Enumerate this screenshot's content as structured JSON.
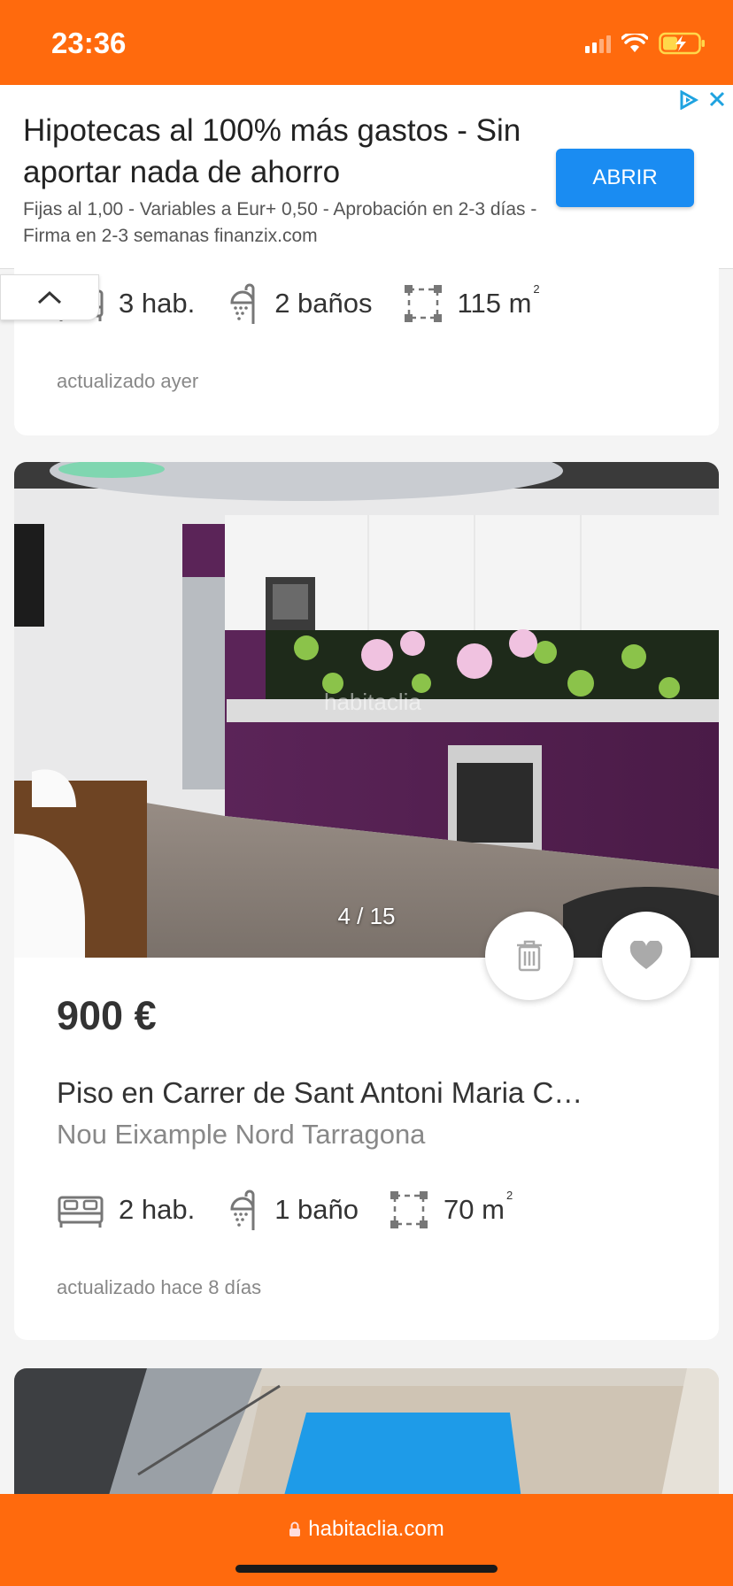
{
  "status_bar": {
    "time": "23:36"
  },
  "ad": {
    "title": "Hipotecas al 100% más gastos - Sin aportar nada de ahorro",
    "description": "Fijas al 1,00 - Variables a Eur+ 0,50 - Aprobación en 2-3 días - Firma en 2-3 semanas finanzix.com",
    "button": "ABRIR"
  },
  "listing1": {
    "rooms": "3 hab.",
    "baths": "2 baños",
    "area": "115 m",
    "area_sup": "2",
    "updated": "actualizado ayer"
  },
  "listing2": {
    "photo_counter": "4 / 15",
    "price": "900 €",
    "title": "Piso en Carrer de Sant Antoni Maria C…",
    "location": "Nou Eixample Nord Tarragona",
    "rooms": "2 hab.",
    "baths": "1 baño",
    "area": "70 m",
    "area_sup": "2",
    "updated": "actualizado hace 8 días"
  },
  "browser": {
    "url": "habitaclia.com"
  },
  "colors": {
    "brand": "#ff6a0d",
    "ad_button": "#1a8cf2"
  },
  "icons": [
    "signal-icon",
    "wifi-icon",
    "battery-charging-icon",
    "adchoices-icon",
    "close-icon",
    "chevron-up-icon",
    "bed-icon",
    "shower-icon",
    "area-icon",
    "trash-icon",
    "heart-icon",
    "lock-icon"
  ]
}
